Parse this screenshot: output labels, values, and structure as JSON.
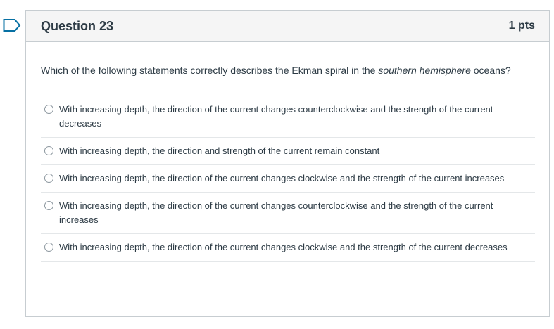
{
  "colors": {
    "bookmark_accent": "#0770a3",
    "text": "#2d3b45",
    "header_bg": "#f5f5f5",
    "border": "#c7cdd1",
    "divider": "#e4e7e9"
  },
  "bookmark": {
    "icon": "bookmark-flag-icon"
  },
  "question": {
    "title": "Question 23",
    "points": "1 pts",
    "text_prefix": "Which of the following statements correctly describes the Ekman spiral in the ",
    "text_emphasis": "southern hemisphere",
    "text_suffix": " oceans?",
    "answers": [
      {
        "label": "With increasing depth, the direction of the current changes counterclockwise and the strength of the current decreases",
        "selected": false
      },
      {
        "label": "With increasing depth, the direction and strength of the current remain constant",
        "selected": false
      },
      {
        "label": "With increasing depth, the direction of the current changes clockwise and the strength of the current increases",
        "selected": false
      },
      {
        "label": "With increasing depth, the direction of the current changes counterclockwise and the strength of the current increases",
        "selected": false
      },
      {
        "label": "With increasing depth, the direction of the current changes clockwise and the strength of the current decreases",
        "selected": false
      }
    ]
  }
}
